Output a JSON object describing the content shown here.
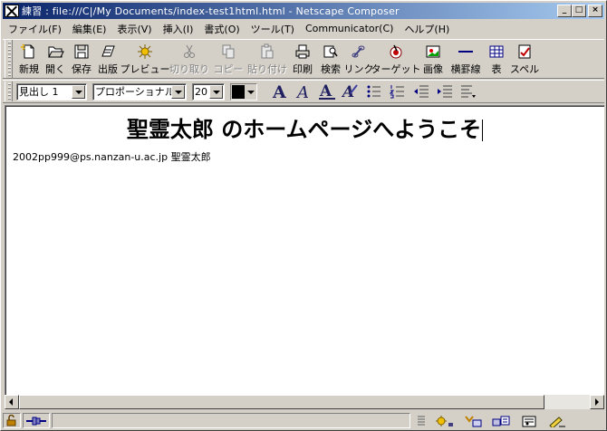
{
  "window": {
    "title": "練習 : file:///C|/My Documents/index-test1html.html - Netscape Composer",
    "minimize": "_",
    "maximize": "□",
    "close": "×"
  },
  "menu": [
    "ファイル(F)",
    "編集(E)",
    "表示(V)",
    "挿入(I)",
    "書式(O)",
    "ツール(T)",
    "Communicator(C)",
    "ヘルプ(H)"
  ],
  "toolbar": [
    {
      "label": "新規",
      "icon": "new-file-icon",
      "disabled": false
    },
    {
      "label": "開く",
      "icon": "open-folder-icon",
      "disabled": false
    },
    {
      "label": "保存",
      "icon": "save-disk-icon",
      "disabled": false
    },
    {
      "label": "出版",
      "icon": "publish-icon",
      "disabled": false
    },
    {
      "label": "プレビュー",
      "icon": "preview-icon",
      "disabled": false
    },
    {
      "label": "切り取り",
      "icon": "cut-icon",
      "disabled": true
    },
    {
      "label": "コピー",
      "icon": "copy-icon",
      "disabled": true
    },
    {
      "label": "貼り付け",
      "icon": "paste-icon",
      "disabled": true
    },
    {
      "label": "印刷",
      "icon": "print-icon",
      "disabled": false
    },
    {
      "label": "検索",
      "icon": "find-icon",
      "disabled": false
    },
    {
      "label": "リンク",
      "icon": "link-icon",
      "disabled": false
    },
    {
      "label": "ターゲット",
      "icon": "target-icon",
      "disabled": false
    },
    {
      "label": "画像",
      "icon": "image-icon",
      "disabled": false
    },
    {
      "label": "横罫線",
      "icon": "horizontal-line-icon",
      "disabled": false
    },
    {
      "label": "表",
      "icon": "table-icon",
      "disabled": false
    },
    {
      "label": "スペル",
      "icon": "spell-check-icon",
      "disabled": false
    }
  ],
  "format": {
    "paragraph_style": "見出し 1",
    "font": "プロポーショナル",
    "font_size": "20",
    "text_color": "#000000"
  },
  "editor": {
    "heading": "聖霊太郎 のホームページへようこそ",
    "body_line": "2002pp999@ps.nanzan-u.ac.jp 聖霊太郎"
  }
}
